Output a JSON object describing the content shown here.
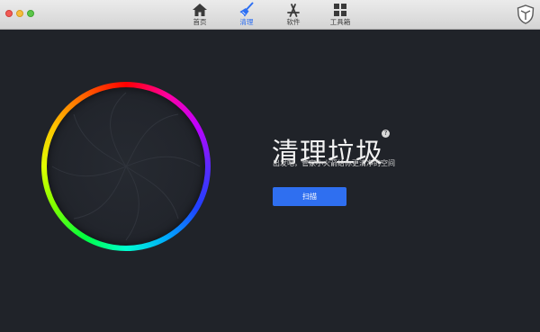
{
  "tabs": [
    {
      "id": "home",
      "label": "首页",
      "icon": "home-icon",
      "active": false
    },
    {
      "id": "clean",
      "label": "清理",
      "icon": "broom-icon",
      "active": true
    },
    {
      "id": "software",
      "label": "软件",
      "icon": "app-store-icon",
      "active": false
    },
    {
      "id": "tools",
      "label": "工具箱",
      "icon": "grid-icon",
      "active": false
    }
  ],
  "main": {
    "title": "清理垃圾",
    "subtitle": "出发吧，管家小火箭给你更清净的空间",
    "scan_label": "扫描",
    "help_glyph": "?"
  },
  "colors": {
    "accent": "#2f6ff0",
    "background": "#202329",
    "toolbar": "#dcdcdc"
  }
}
